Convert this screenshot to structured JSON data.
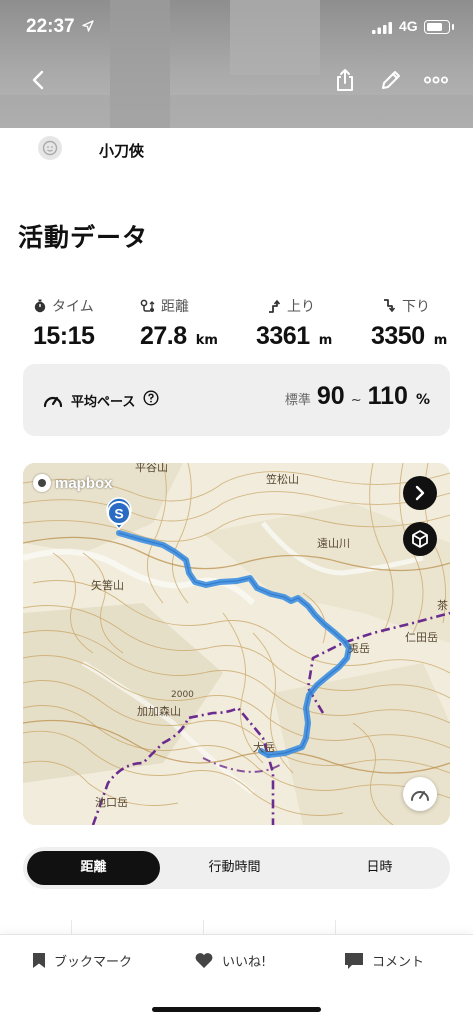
{
  "status_bar": {
    "time": "22:37",
    "network": "4G",
    "battery_level": 0.85
  },
  "header": {
    "back_icon": "chevron-left-icon",
    "share_icon": "share-icon",
    "edit_icon": "pencil-icon",
    "more_icon": "more-horizontal-icon"
  },
  "user": {
    "name": "小刀俠"
  },
  "activity": {
    "section_title": "活動データ",
    "stats": [
      {
        "icon": "stopwatch-icon",
        "label": "タイム",
        "value": "15:15",
        "unit": ""
      },
      {
        "icon": "route-icon",
        "label": "距離",
        "value": "27.8",
        "unit": "km"
      },
      {
        "icon": "ascent-icon",
        "label": "上り",
        "value": "3361",
        "unit": "m"
      },
      {
        "icon": "descent-icon",
        "label": "下り",
        "value": "3350",
        "unit": "m"
      }
    ],
    "pace": {
      "label": "平均ペース",
      "standard_label": "標準",
      "min": "90",
      "separator": "~",
      "max": "110",
      "unit": "%"
    }
  },
  "map": {
    "provider": "mapbox",
    "start_marker": "S",
    "route_color": "#3d8fe0",
    "trail_color": "#6a2c8f",
    "place_labels": [
      "平谷山",
      "笠松山",
      "遠山川",
      "矢筈山",
      "兎岳",
      "仁田岳",
      "茶",
      "加加森山",
      "大岳",
      "池口岳",
      "2000"
    ]
  },
  "segmented_control": {
    "options": [
      "距離",
      "行動時間",
      "日時"
    ],
    "selected": 0
  },
  "bottom_bar": {
    "bookmark": "ブックマーク",
    "like": "いいね!",
    "comment": "コメント"
  }
}
